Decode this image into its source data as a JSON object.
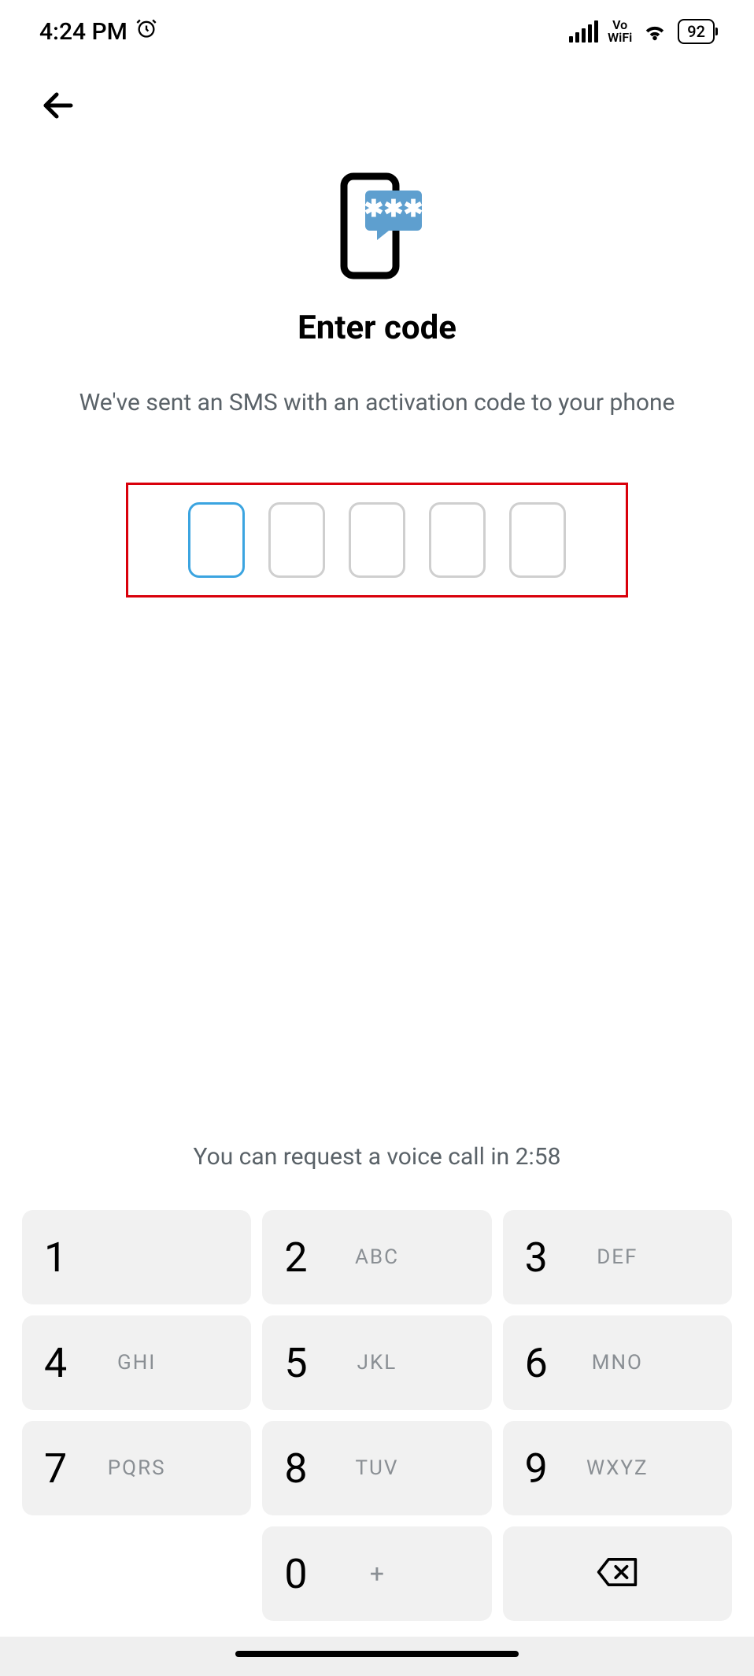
{
  "status": {
    "time": "4:24 PM",
    "vowifi_top": "Vo",
    "vowifi_bottom": "WiFi",
    "battery": "92"
  },
  "screen": {
    "title": "Enter code",
    "subtitle": "We've sent an SMS with an activation code to your phone",
    "voice_call_text": "You can request a voice call in 2:58"
  },
  "code_input": {
    "digits": [
      "",
      "",
      "",
      "",
      ""
    ],
    "active_index": 0
  },
  "keypad": {
    "keys": [
      {
        "num": "1",
        "letters": ""
      },
      {
        "num": "2",
        "letters": "ABC"
      },
      {
        "num": "3",
        "letters": "DEF"
      },
      {
        "num": "4",
        "letters": "GHI"
      },
      {
        "num": "5",
        "letters": "JKL"
      },
      {
        "num": "6",
        "letters": "MNO"
      },
      {
        "num": "7",
        "letters": "PQRS"
      },
      {
        "num": "8",
        "letters": "TUV"
      },
      {
        "num": "9",
        "letters": "WXYZ"
      },
      {
        "num": "0",
        "letters": "+"
      }
    ]
  }
}
